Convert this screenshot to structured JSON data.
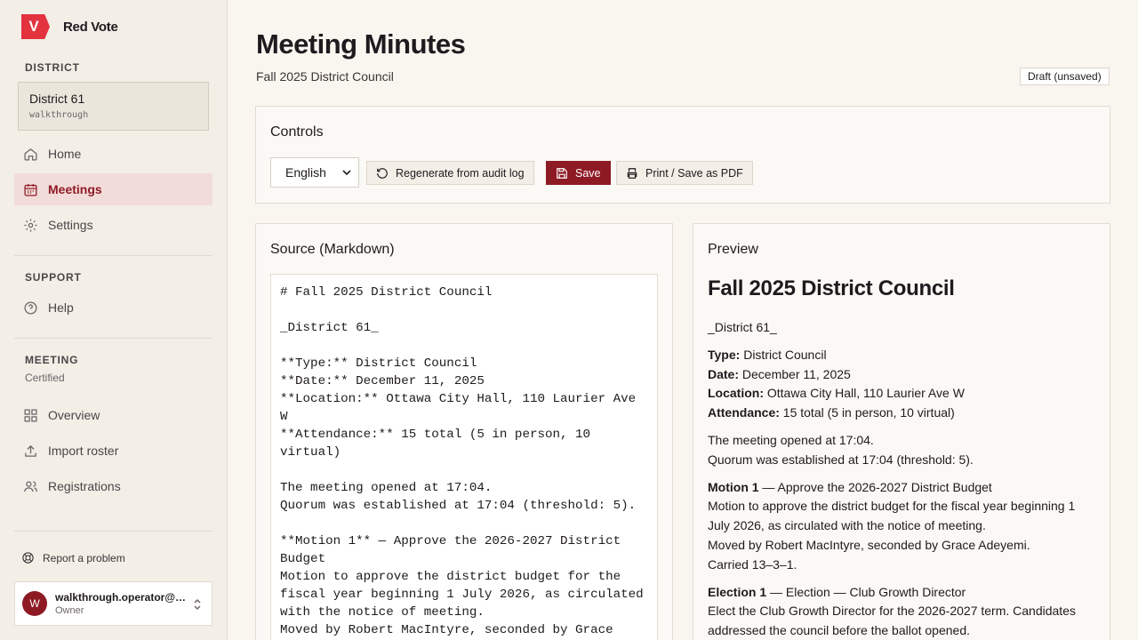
{
  "brand": {
    "logo_letter": "V",
    "name": "Red Vote",
    "accent": "#e2333f"
  },
  "sidebar": {
    "district_label": "DISTRICT",
    "district": {
      "name": "District 61",
      "slug": "walkthrough"
    },
    "main_nav": [
      {
        "label": "Home",
        "icon": "home-icon"
      },
      {
        "label": "Meetings",
        "icon": "calendar-icon",
        "active": true
      },
      {
        "label": "Settings",
        "icon": "gear-icon"
      }
    ],
    "support_label": "SUPPORT",
    "support_nav": [
      {
        "label": "Help",
        "icon": "help-icon"
      }
    ],
    "meeting_label": "MEETING",
    "meeting_status": "Certified",
    "meeting_nav": [
      {
        "label": "Overview",
        "icon": "grid-icon"
      },
      {
        "label": "Import roster",
        "icon": "upload-icon"
      },
      {
        "label": "Registrations",
        "icon": "users-icon"
      }
    ],
    "report_label": "Report a problem",
    "user": {
      "initial": "W",
      "email": "walkthrough.operator@ta...",
      "role": "Owner"
    }
  },
  "header": {
    "title": "Meeting Minutes",
    "subtitle": "Fall 2025 District Council",
    "badge": "Draft (unsaved)"
  },
  "controls": {
    "title": "Controls",
    "language": "English",
    "regenerate_label": "Regenerate from audit log",
    "save_label": "Save",
    "print_label": "Print / Save as PDF",
    "save_color": "#8e1a24"
  },
  "source": {
    "title": "Source (Markdown)",
    "text": "# Fall 2025 District Council\n\n_District 61_\n\n**Type:** District Council\n**Date:** December 11, 2025\n**Location:** Ottawa City Hall, 110 Laurier Ave W\n**Attendance:** 15 total (5 in person, 10 virtual)\n\nThe meeting opened at 17:04.\nQuorum was established at 17:04 (threshold: 5).\n\n**Motion 1** — Approve the 2026-2027 District Budget\nMotion to approve the district budget for the fiscal year beginning 1 July 2026, as circulated with the notice of meeting.\nMoved by Robert MacIntyre, seconded by Grace Adeyemi."
  },
  "preview": {
    "title": "Preview",
    "heading": "Fall 2025 District Council",
    "district_line": "_District 61_",
    "type_label": "Type:",
    "type_value": " District Council",
    "date_label": "Date:",
    "date_value": " December 11, 2025",
    "location_label": "Location:",
    "location_value": " Ottawa City Hall, 110 Laurier Ave W",
    "attendance_label": "Attendance:",
    "attendance_value": " 15 total (5 in person, 10 virtual)",
    "opened": "The meeting opened at 17:04.",
    "quorum": "Quorum was established at 17:04 (threshold: 5).",
    "motion_label": "Motion 1",
    "motion_title": " — Approve the 2026-2027 District Budget",
    "motion_desc": "Motion to approve the district budget for the fiscal year beginning 1 July 2026, as circulated with the notice of meeting.",
    "motion_moved": "Moved by Robert MacIntyre, seconded by Grace Adeyemi.",
    "motion_result": "Carried 13–3–1.",
    "election_label": "Election 1",
    "election_title": " — Election — Club Growth Director",
    "election_desc": "Elect the Club Growth Director for the 2026-2027 term. Candidates addressed the council before the ballot opened."
  }
}
